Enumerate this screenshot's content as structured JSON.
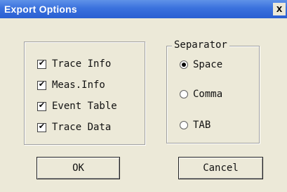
{
  "window": {
    "title": "Export Options",
    "close_glyph": "x"
  },
  "checkboxes": [
    {
      "label": "Trace Info",
      "checked": true
    },
    {
      "label": "Meas.Info",
      "checked": true
    },
    {
      "label": "Event Table",
      "checked": true
    },
    {
      "label": "Trace Data",
      "checked": true
    }
  ],
  "checkmark_glyph": "✔",
  "separator": {
    "caption": "Separator",
    "options": [
      {
        "label": "Space",
        "selected": true
      },
      {
        "label": "Comma",
        "selected": false
      },
      {
        "label": "TAB",
        "selected": false
      }
    ]
  },
  "buttons": {
    "ok_label": "OK",
    "cancel_label": "Cancel"
  },
  "colors": {
    "title_bar": "#2a5fd2",
    "dialog_background": "#ece9d8"
  }
}
